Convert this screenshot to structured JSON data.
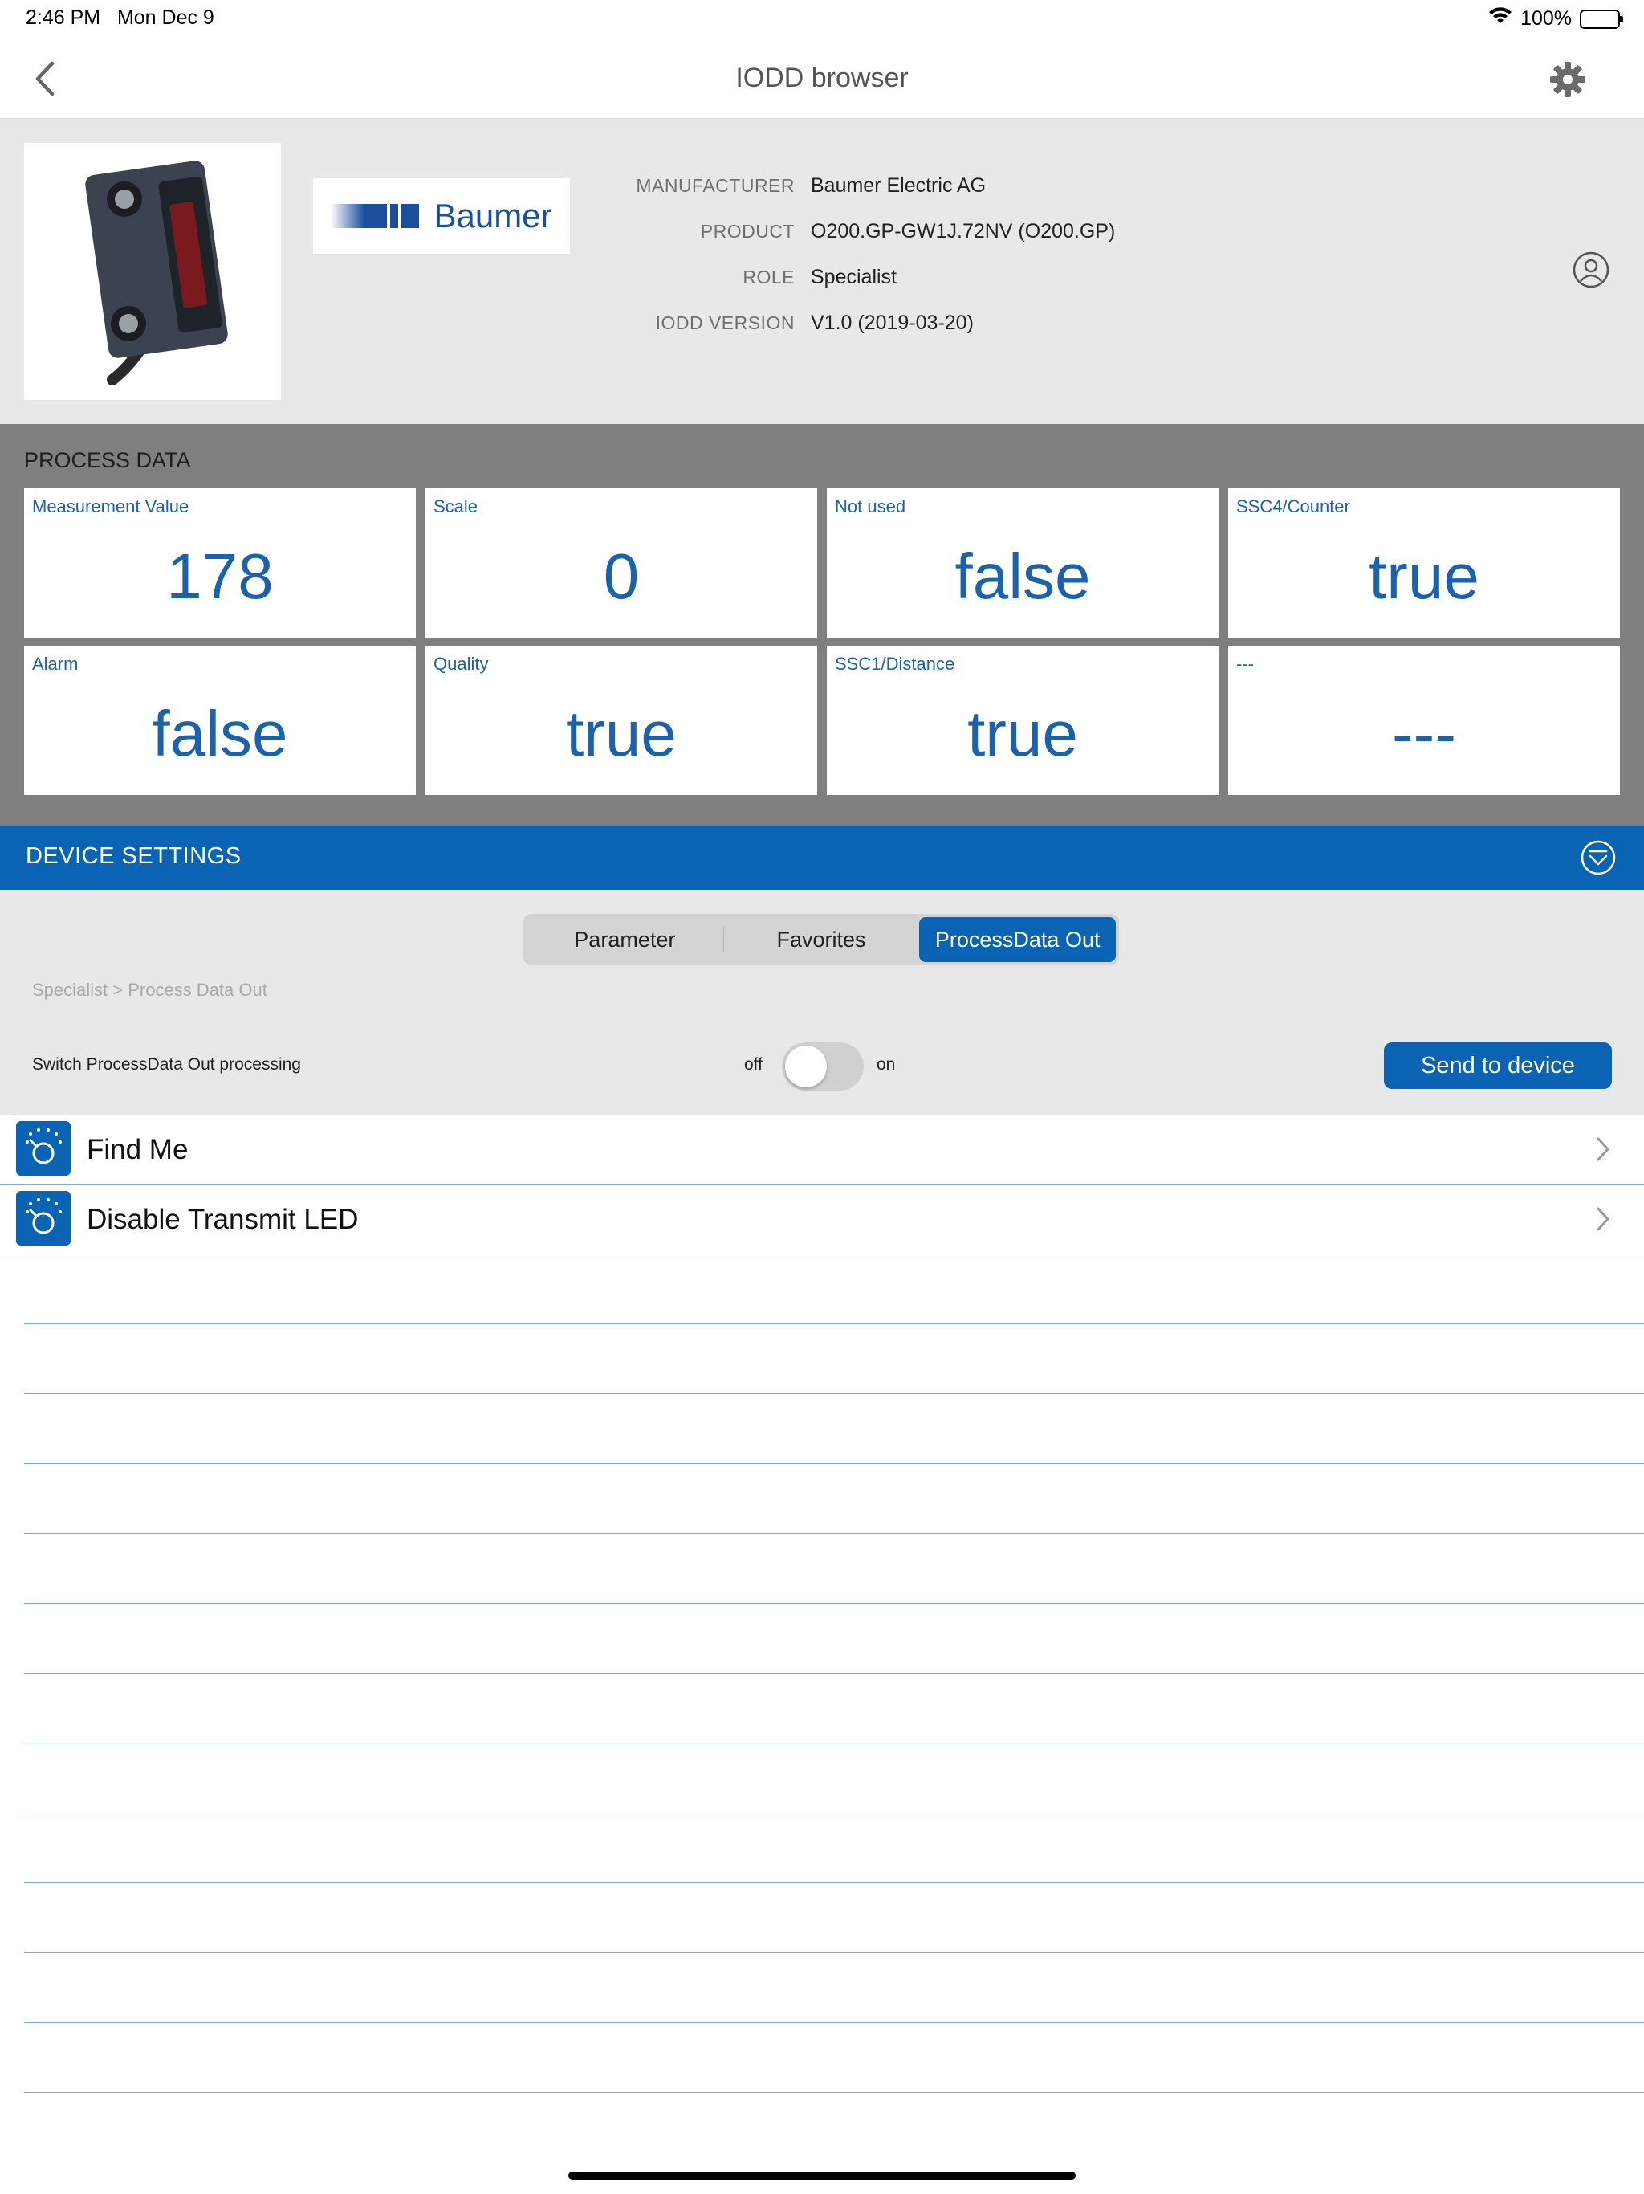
{
  "status_bar": {
    "time": "2:46 PM",
    "date": "Mon Dec 9",
    "battery": "100%"
  },
  "nav": {
    "title": "IODD browser"
  },
  "device": {
    "brand": "Baumer",
    "info": [
      {
        "label": "MANUFACTURER",
        "value": "Baumer Electric AG"
      },
      {
        "label": "PRODUCT",
        "value": "O200.GP-GW1J.72NV (O200.GP)"
      },
      {
        "label": "ROLE",
        "value": "Specialist"
      },
      {
        "label": "IODD VERSION",
        "value": "V1.0 (2019-03-20)"
      }
    ]
  },
  "process_data": {
    "title": "PROCESS DATA",
    "tiles": [
      {
        "label": "Measurement Value",
        "value": "178"
      },
      {
        "label": "Scale",
        "value": "0"
      },
      {
        "label": "Not used",
        "value": "false"
      },
      {
        "label": "SSC4/Counter",
        "value": "true"
      },
      {
        "label": "Alarm",
        "value": "false"
      },
      {
        "label": "Quality",
        "value": "true"
      },
      {
        "label": "SSC1/Distance",
        "value": "true"
      },
      {
        "label": "---",
        "value": "---"
      }
    ]
  },
  "device_settings": {
    "title": "DEVICE SETTINGS",
    "tabs": [
      {
        "label": "Parameter",
        "active": false
      },
      {
        "label": "Favorites",
        "active": false
      },
      {
        "label": "ProcessData Out",
        "active": true
      }
    ],
    "breadcrumb": "Specialist > Process Data Out",
    "switch_label": "Switch ProcessData Out processing",
    "off_label": "off",
    "on_label": "on",
    "switch_on": false,
    "send_button": "Send to device"
  },
  "list": {
    "items": [
      {
        "label": "Find Me",
        "icon": "knob-icon"
      },
      {
        "label": "Disable Transmit LED",
        "icon": "knob-icon"
      }
    ]
  },
  "colors": {
    "accent": "#0a64b3",
    "process_bg": "#7f7f7f",
    "header_bg": "#e8e8e8",
    "tile_text": "#1a62ad"
  }
}
